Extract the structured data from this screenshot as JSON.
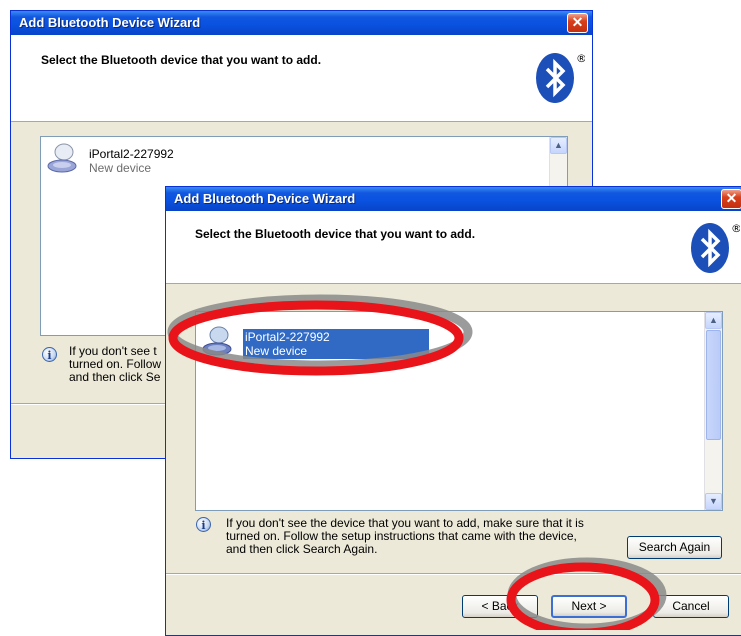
{
  "back_window": {
    "title": "Add Bluetooth Device Wizard",
    "close_label": "✕",
    "header_text": "Select the Bluetooth device that you want to add.",
    "device": {
      "name": "iPortal2-227992",
      "status": "New device"
    },
    "info_lines": [
      "If you don't see t",
      "turned on. Follow",
      "and then click Se"
    ]
  },
  "front_window": {
    "title": "Add Bluetooth Device Wizard",
    "close_label": "✕",
    "header_text": "Select the Bluetooth device that you want to add.",
    "device": {
      "name": "iPortal2-227992",
      "status": "New device",
      "selected": true
    },
    "info_lines": [
      "If you don't see the device that you want to add, make sure that it is",
      "turned on. Follow the setup instructions that came with the device,",
      "and then click Search Again."
    ],
    "search_again_label": "Search Again",
    "back_label": "< Back",
    "next_label": "Next >",
    "cancel_label": "Cancel"
  },
  "annotations": {
    "highlight_color": "#e8141a",
    "shadow_color": "#8a8a8a"
  },
  "colors": {
    "selection": "#316ac5",
    "titlebar": "#0a52e0",
    "bluetooth": "#1d4fb8"
  }
}
